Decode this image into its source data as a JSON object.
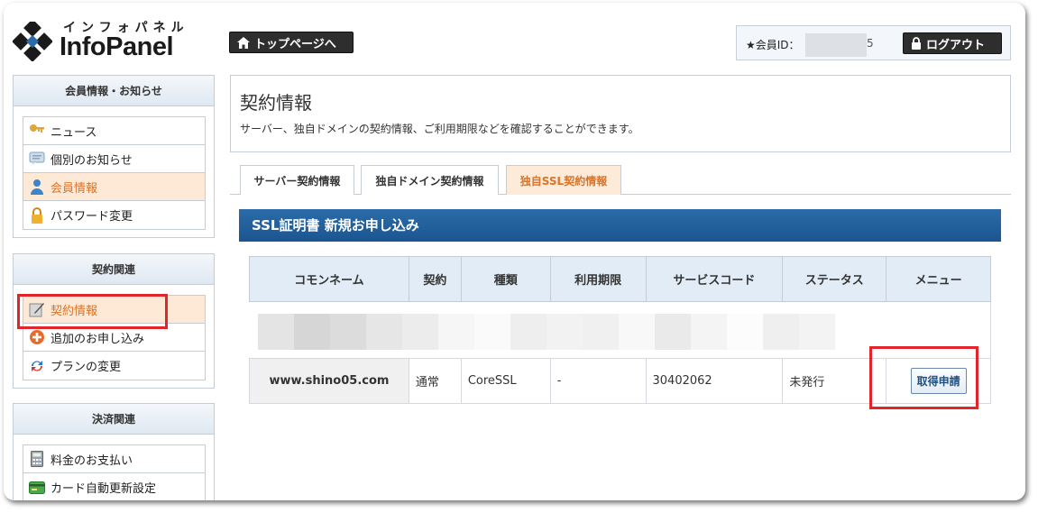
{
  "logo": {
    "kana": "インフォパネル",
    "name": "InfoPanel"
  },
  "header": {
    "top_page_label": "トップページへ",
    "member_id_label": "★会員ID：",
    "member_id_tail": "5",
    "logout_label": "ログアウト"
  },
  "sidebar": {
    "sections": [
      {
        "title": "会員情報・お知らせ",
        "items": [
          {
            "label": "ニュース",
            "icon": "key-icon"
          },
          {
            "label": "個別のお知らせ",
            "icon": "memo-icon"
          },
          {
            "label": "会員情報",
            "icon": "user-icon"
          },
          {
            "label": "パスワード変更",
            "icon": "lock-icon"
          }
        ]
      },
      {
        "title": "契約関連",
        "items": [
          {
            "label": "契約情報",
            "icon": "pen-document-icon"
          },
          {
            "label": "追加のお申し込み",
            "icon": "plus-circle-icon"
          },
          {
            "label": "プランの変更",
            "icon": "refresh-icon"
          }
        ]
      },
      {
        "title": "決済関連",
        "items": [
          {
            "label": "料金のお支払い",
            "icon": "calculator-icon"
          },
          {
            "label": "カード自動更新設定",
            "icon": "credit-card-icon"
          }
        ]
      }
    ]
  },
  "main": {
    "title": "契約情報",
    "description": "サーバー、独自ドメインの契約情報、ご利用期限などを確認することができます。",
    "tabs": [
      "サーバー契約情報",
      "独自ドメイン契約情報",
      "独自SSL契約情報"
    ],
    "active_tab": 2,
    "section_title": "SSL証明書 新規お申し込み",
    "table": {
      "headers": [
        "コモンネーム",
        "契約",
        "種類",
        "利用期限",
        "サービスコード",
        "ステータス",
        "メニュー"
      ],
      "row": {
        "common_name": "www.shino05.com",
        "contract": "通常",
        "type": "CoreSSL",
        "expiry": "-",
        "service_code": "30402062",
        "status": "未発行",
        "menu_button": "取得申請"
      }
    }
  },
  "colors": {
    "accent_orange": "#d9742a",
    "header_blue": "#1b5590",
    "highlight_red": "#e0262a"
  }
}
